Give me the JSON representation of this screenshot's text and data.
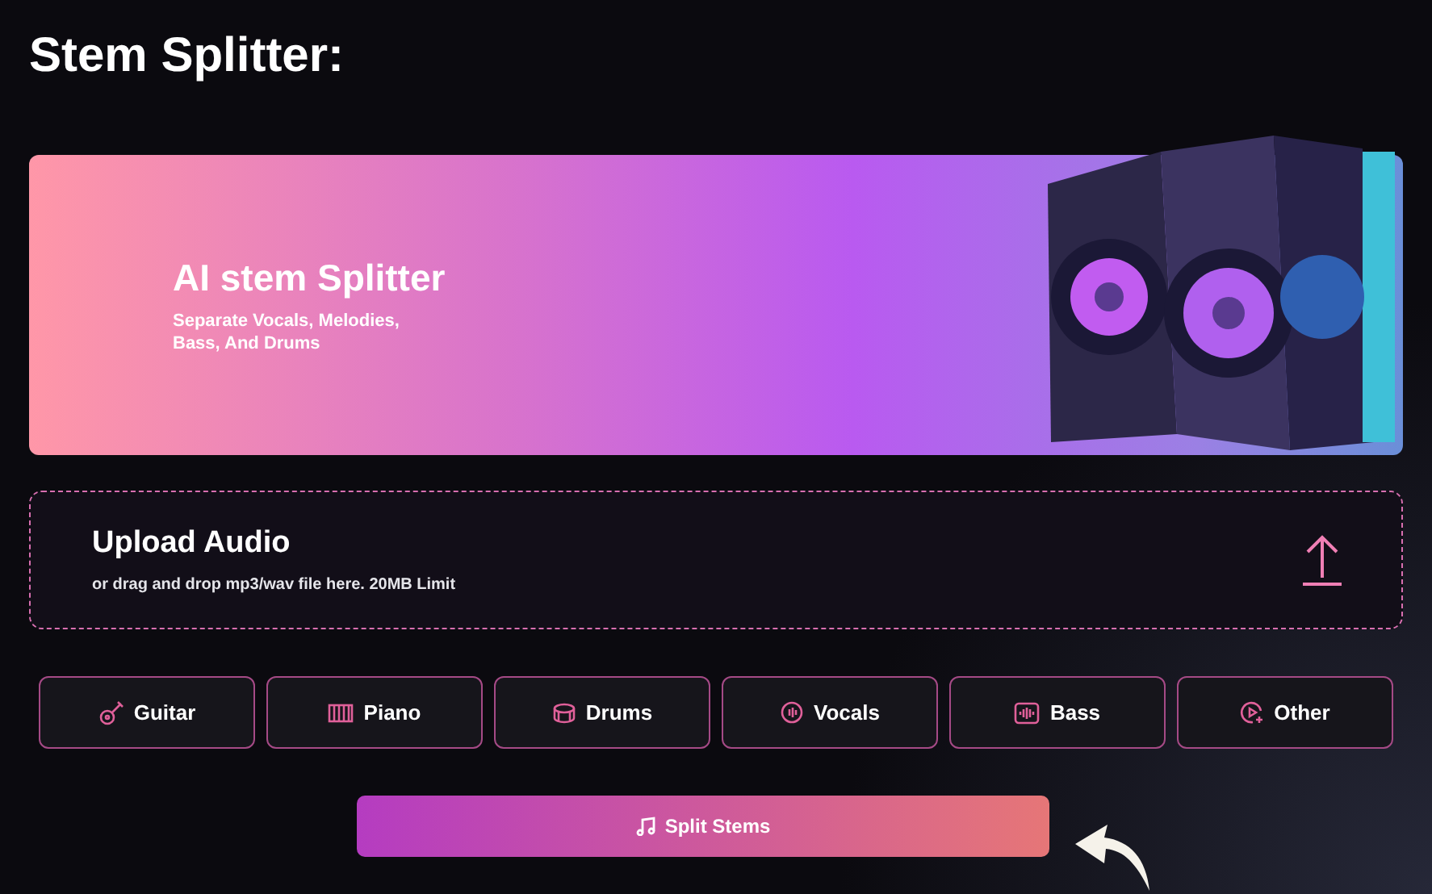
{
  "page_title": "Stem Splitter:",
  "banner": {
    "title": "AI stem Splitter",
    "subtitle": "Separate Vocals, Melodies, Bass, And Drums"
  },
  "upload": {
    "title": "Upload Audio",
    "hint": "or drag and drop mp3/wav file here. 20MB Limit"
  },
  "stems": [
    {
      "label": "Guitar",
      "kind": "guitar"
    },
    {
      "label": "Piano",
      "kind": "piano"
    },
    {
      "label": "Drums",
      "kind": "drums"
    },
    {
      "label": "Vocals",
      "kind": "vocals"
    },
    {
      "label": "Bass",
      "kind": "bass"
    },
    {
      "label": "Other",
      "kind": "other"
    }
  ],
  "split_button": {
    "label": "Split Stems"
  }
}
